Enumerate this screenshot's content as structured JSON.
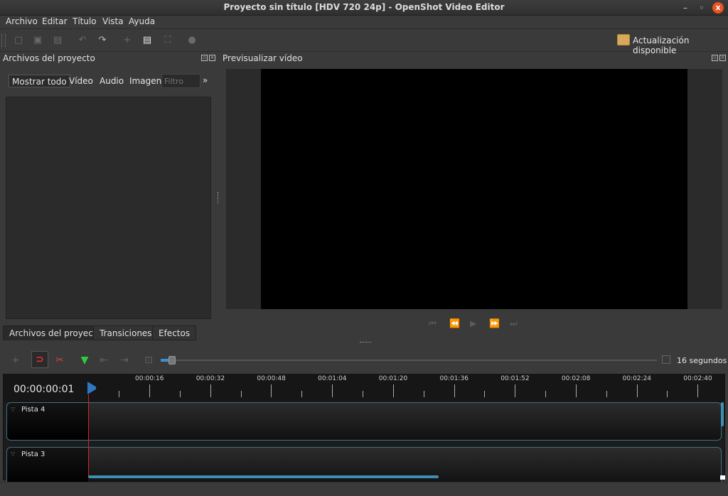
{
  "window": {
    "title": "Proyecto sin título [HDV 720 24p] - OpenShot Video Editor",
    "close_glyph": "x"
  },
  "menu": [
    "Archivo",
    "Editar",
    "Título",
    "Vista",
    "Ayuda"
  ],
  "toolbar": {
    "update_label": "Actualización disponible"
  },
  "project_panel": {
    "title": "Archivos del proyecto",
    "filter_tabs": [
      "Mostrar todo",
      "Vídeo",
      "Audio",
      "Imagen"
    ],
    "filter_placeholder": "Filtro",
    "more": "»"
  },
  "bottom_tabs": [
    "Archivos del proyecto",
    "Transiciones",
    "Efectos"
  ],
  "preview_panel": {
    "title": "Previsualizar vídeo"
  },
  "timeline": {
    "zoom_label": "16 segundos",
    "timecode": "00:00:00:01",
    "ruler_labels": [
      "00:00:16",
      "00:00:32",
      "00:00:48",
      "00:01:04",
      "00:01:20",
      "00:01:36",
      "00:01:52",
      "00:02:08",
      "00:02:24",
      "00:02:40"
    ],
    "tracks": [
      "Pista 4",
      "Pista 3"
    ]
  },
  "colors": {
    "accent": "#3d8fd4",
    "playhead": "#e02020",
    "close": "#e95420",
    "marker": "#2ecc40"
  }
}
